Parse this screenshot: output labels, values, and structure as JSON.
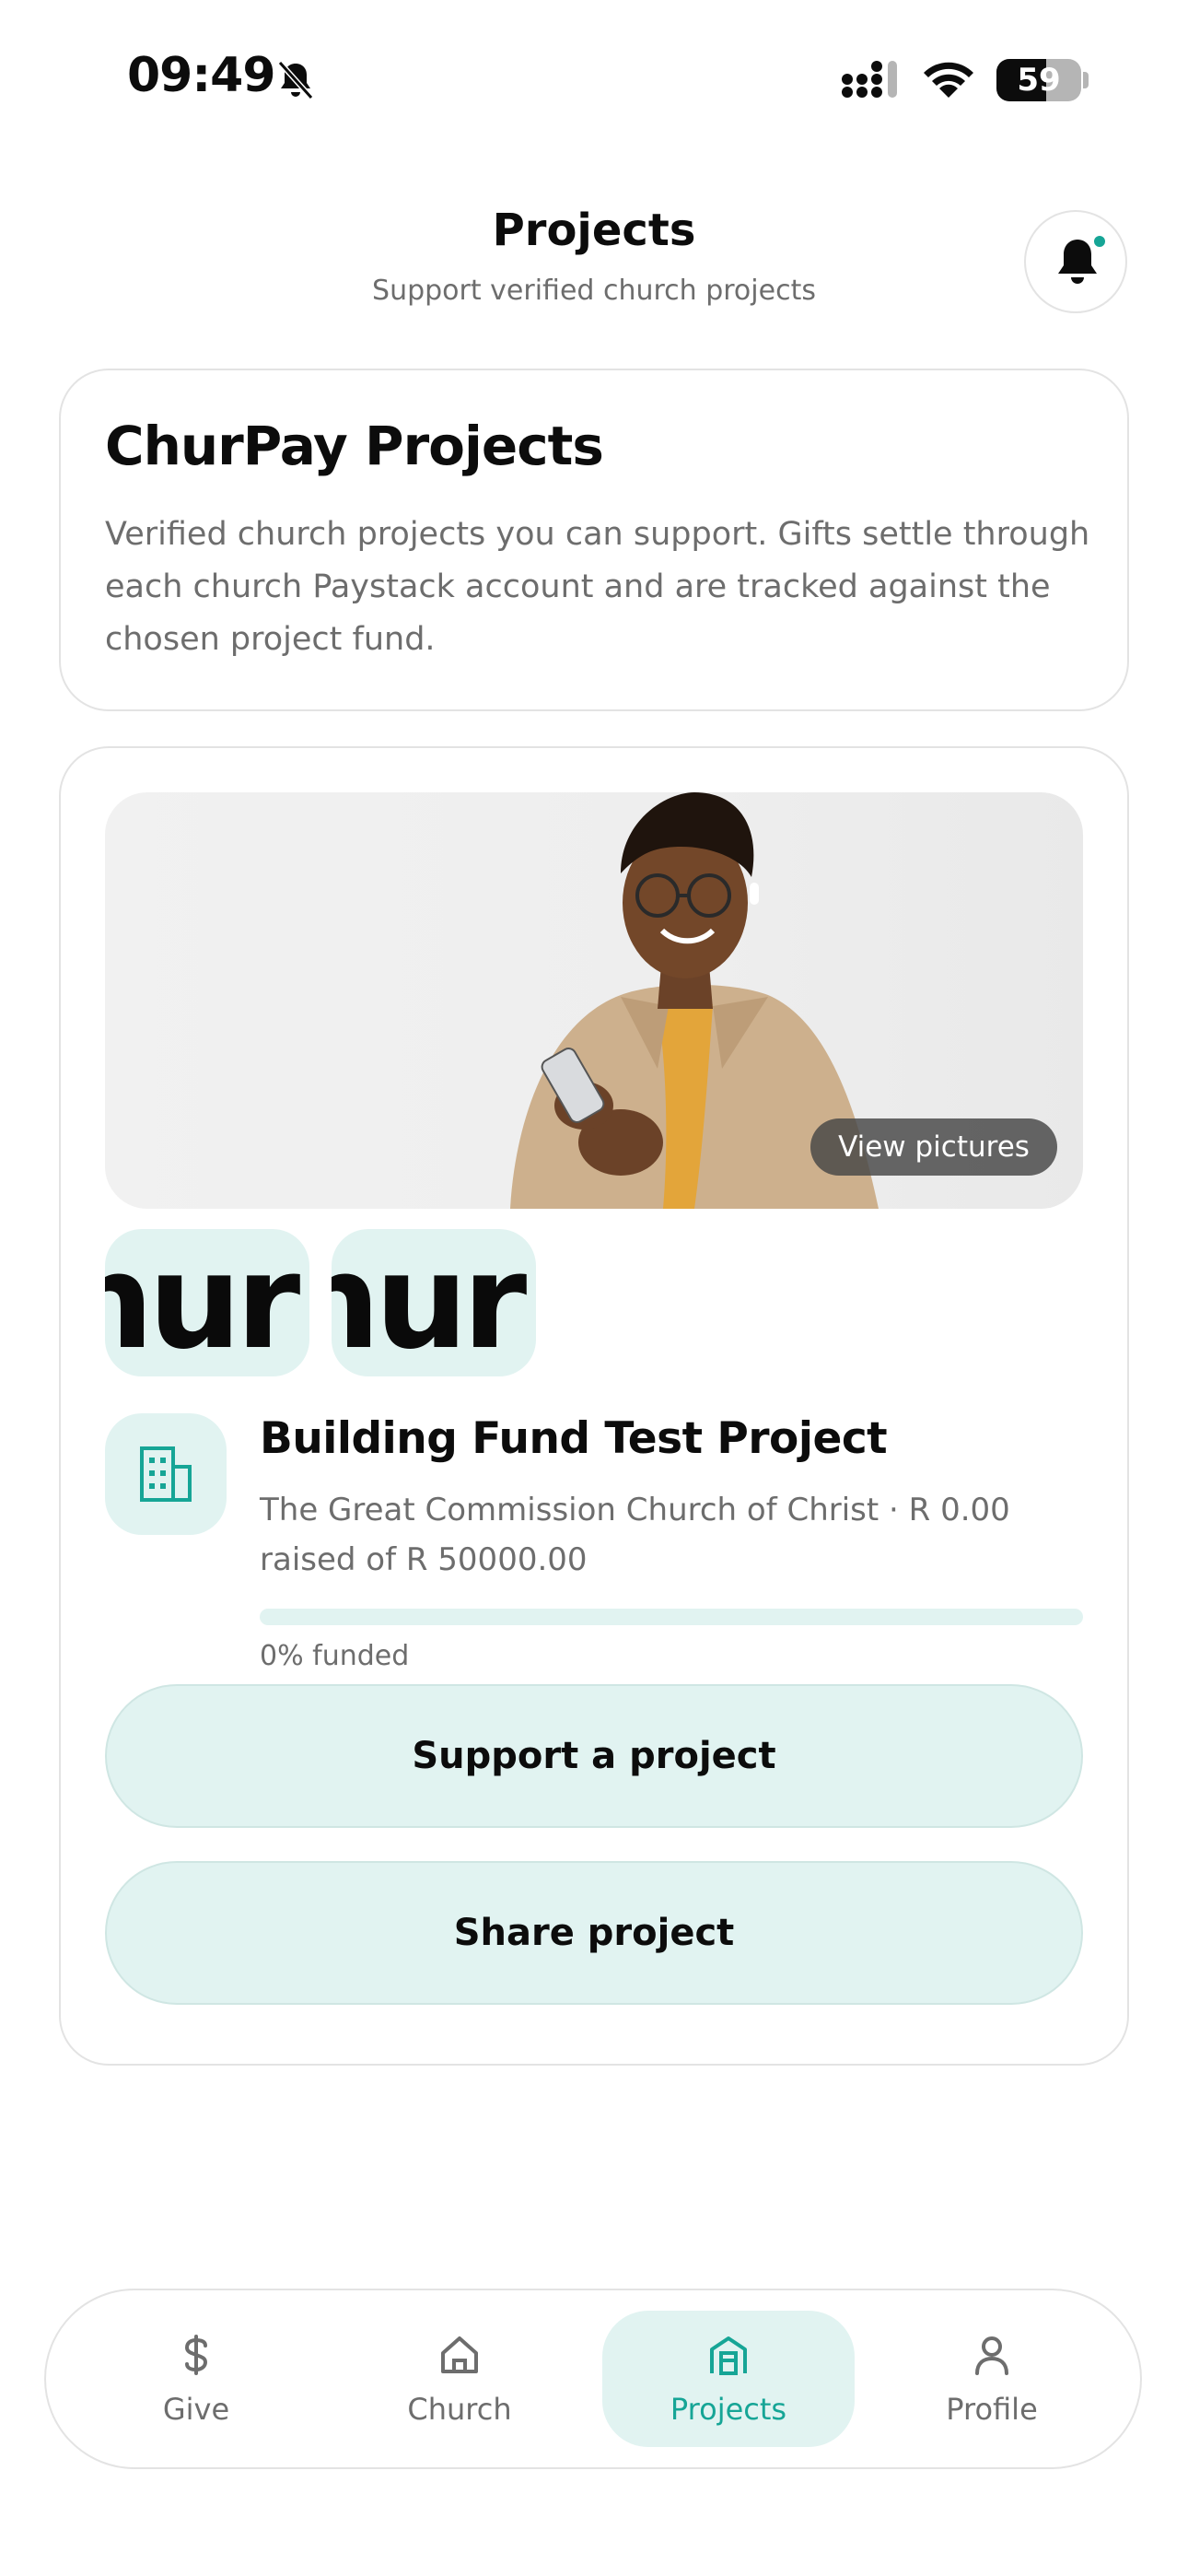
{
  "status_bar": {
    "time": "09:49",
    "battery": "59",
    "battery_level": 0.59
  },
  "header": {
    "title": "Projects",
    "subtitle": "Support verified church projects"
  },
  "intro": {
    "title": "ChurPay Projects",
    "description": "Verified church projects you can support. Gifts settle through each church Paystack account and are tracked against the chosen project fund."
  },
  "project": {
    "view_pictures_label": "View pictures",
    "thumbnails": [
      "hur",
      "hur"
    ],
    "name": "Building Fund Test Project",
    "meta": "The Great Commission Church of Christ · R 0.00 raised of R 50000.00",
    "funded_fraction": 0,
    "funded_label": "0% funded",
    "support_button": "Support a project",
    "share_button": "Share project"
  },
  "nav": {
    "items": [
      {
        "label": "Give",
        "icon": "dollar-icon"
      },
      {
        "label": "Church",
        "icon": "home-icon"
      },
      {
        "label": "Projects",
        "icon": "building-icon",
        "active": true
      },
      {
        "label": "Profile",
        "icon": "person-icon"
      }
    ]
  },
  "colors": {
    "accent": "#16a596",
    "accent_soft": "#e1f3f1",
    "text_muted": "#6d6d6d"
  }
}
